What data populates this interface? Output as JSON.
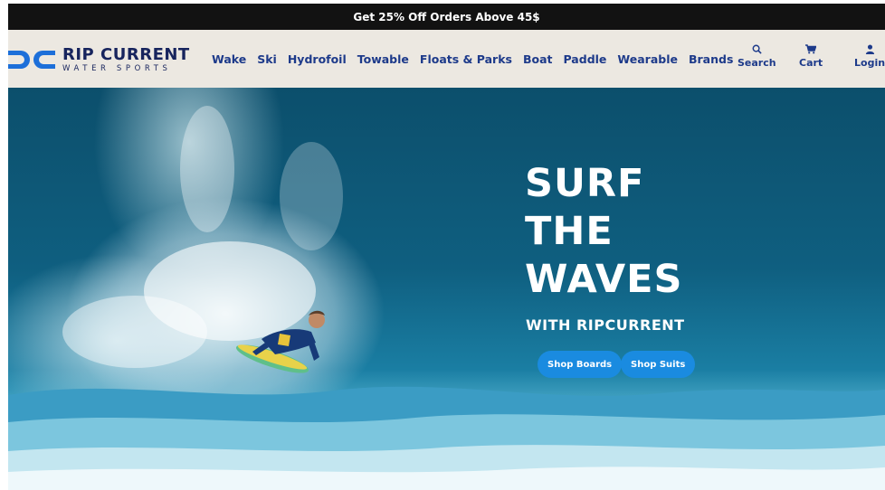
{
  "promo": {
    "text": "Get 25% Off Orders Above 45$"
  },
  "brand": {
    "name": "RIP CURRENT",
    "tagline": "WATER SPORTS",
    "color": "#17245d",
    "mark_color": "#1d6fd9"
  },
  "nav": {
    "items": [
      {
        "label": "Wake"
      },
      {
        "label": "Ski"
      },
      {
        "label": "Hydrofoil"
      },
      {
        "label": "Towable"
      },
      {
        "label": "Floats & Parks"
      },
      {
        "label": "Boat"
      },
      {
        "label": "Paddle"
      },
      {
        "label": "Wearable"
      },
      {
        "label": "Brands"
      }
    ],
    "actions": {
      "search": {
        "label": "Search",
        "icon": "search-icon"
      },
      "cart": {
        "label": "Cart",
        "icon": "cart-icon"
      },
      "login": {
        "label": "Login",
        "icon": "user-icon"
      }
    },
    "link_color": "#1d3a8a",
    "background": "#ece8e1"
  },
  "hero": {
    "headline": [
      "SURF",
      "THE",
      "WAVES"
    ],
    "subheadline": "WITH RIPCURRENT",
    "buttons": [
      {
        "label": "Shop Boards"
      },
      {
        "label": "Shop Suits"
      }
    ],
    "button_color": "#1a8be0"
  }
}
